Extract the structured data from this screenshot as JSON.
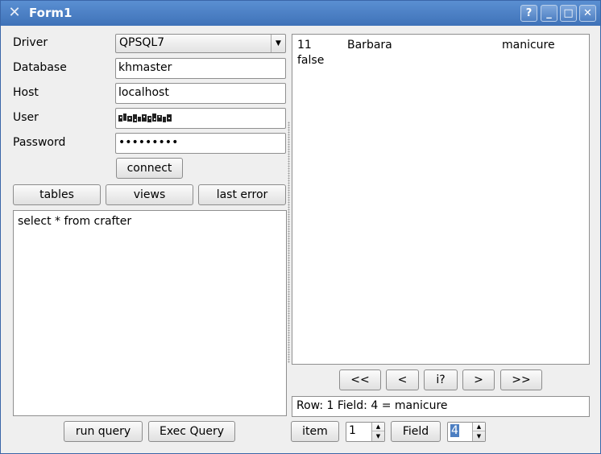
{
  "window": {
    "title": "Form1",
    "help_glyph": "?",
    "minimize_glyph": "_",
    "maximize_glyph": "□",
    "close_glyph": "✕"
  },
  "form": {
    "driver_label": "Driver",
    "driver_value": "QPSQL7",
    "database_label": "Database",
    "database_value": "khmaster",
    "host_label": "Host",
    "host_value": "localhost",
    "user_label": "User",
    "password_label": "Password",
    "password_mask": "•••••••••",
    "connect_label": "connect"
  },
  "actions": {
    "tables_label": "tables",
    "views_label": "views",
    "last_error_label": "last error"
  },
  "query": {
    "text": "select * from crafter",
    "run_query_label": "run query",
    "exec_query_label": "Exec Query"
  },
  "results": {
    "row": [
      "11",
      "Barbara",
      "manicure"
    ],
    "row_wrap": "false"
  },
  "navigation": {
    "first": "<<",
    "prev": "<",
    "info": "i?",
    "next": ">",
    "last": ">>"
  },
  "status_text": "Row: 1 Field: 4 = manicure",
  "bottom": {
    "item_label": "item",
    "item_value": "1",
    "field_label": "Field",
    "field_value": "4"
  },
  "colors": {
    "titlebar": "#3f72b8",
    "window_bg": "#efefef",
    "selection": "#4d7fc2"
  }
}
